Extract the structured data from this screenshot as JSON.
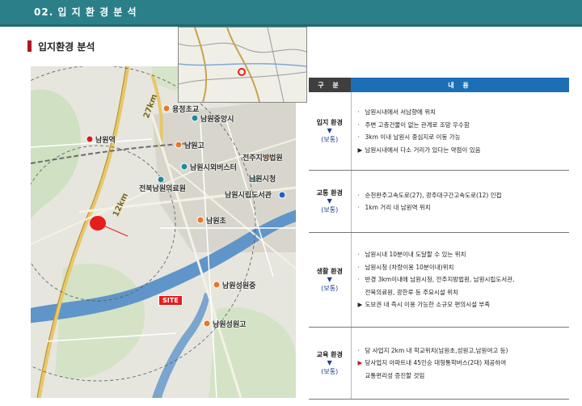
{
  "header": {
    "title": "02. 입 지 환 경 분 석"
  },
  "section": {
    "title": "입지환경 분석"
  },
  "map": {
    "site_label": "SITE",
    "road_labels": [
      "27km",
      "12km"
    ],
    "places": [
      {
        "label": "남원역",
        "kind": "station"
      },
      {
        "label": "용정초교",
        "kind": "school"
      },
      {
        "label": "남원중앙시",
        "kind": "facility"
      },
      {
        "label": "남원고",
        "kind": "school"
      },
      {
        "label": "남원시외버스터",
        "kind": "facility"
      },
      {
        "label": "전북남원의료원",
        "kind": "facility"
      },
      {
        "label": "전주지방법원",
        "kind": "facility"
      },
      {
        "label": "남원시청",
        "kind": "facility"
      },
      {
        "label": "남원시립도서관",
        "kind": "facility"
      },
      {
        "label": "남원초",
        "kind": "school"
      },
      {
        "label": "남원성원중",
        "kind": "school"
      },
      {
        "label": "남원성원고",
        "kind": "school"
      }
    ]
  },
  "table": {
    "header_category": "구 분",
    "header_content": "내 용",
    "rows": [
      {
        "category": "입지 환경",
        "arrow": "▼",
        "rating": "(보통)",
        "items": [
          {
            "mark": "·",
            "text": "남원시내에서 서남향에 위치",
            "emph": false,
            "cont": false
          },
          {
            "mark": "·",
            "text": "주변 고층건물이 없는 관계로 조망 우수함",
            "emph": false,
            "cont": false
          },
          {
            "mark": "·",
            "text": "3km 이내 남원시 중심지로 이동 가능",
            "emph": false,
            "cont": false
          },
          {
            "mark": "▶",
            "text": "남원시내에서 다소 거리가 있다는 약점이 있음",
            "emph": false,
            "cont": false
          }
        ]
      },
      {
        "category": "교통 환경",
        "arrow": "▼",
        "rating": "(보통)",
        "items": [
          {
            "mark": "·",
            "text": "순천완주고속도로(27), 광주대구간고속도로(12) 인접",
            "emph": false,
            "cont": false
          },
          {
            "mark": "·",
            "text": "1km 거리 내 남원역 위치",
            "emph": false,
            "cont": false
          }
        ]
      },
      {
        "category": "생활 환경",
        "arrow": "▼",
        "rating": "(보통)",
        "items": [
          {
            "mark": "·",
            "text": "남원시내 10분이내 도달할 수 있는 위치",
            "emph": false,
            "cont": false
          },
          {
            "mark": "·",
            "text": "남원시청 (차량이용 10분이내)위치",
            "emph": false,
            "cont": false
          },
          {
            "mark": "·",
            "text": "반경 3km이내에 남원시청, 전주지방법원, 남원시립도서관,",
            "emph": false,
            "cont": false
          },
          {
            "mark": "",
            "text": "전북의료원, 광한루 등 주요시설 위치",
            "emph": false,
            "cont": true
          },
          {
            "mark": "▶",
            "text": "도보권 내 즉시 이용 가능한 소규모 편의시설 부족",
            "emph": false,
            "cont": false
          }
        ]
      },
      {
        "category": "교육 환경",
        "arrow": "▼",
        "rating": "(보통)",
        "items": [
          {
            "mark": "·",
            "text": "당 사업지 2km 내 학교위치(남원초,성원고,남원여고 등)",
            "emph": false,
            "cont": false
          },
          {
            "mark": "▶",
            "text": "당사업지 아파트내 45인승 대형통학버스(2대) 제공하여",
            "emph": true,
            "cont": false
          },
          {
            "mark": "",
            "text": "교통편리성 증진할 것임",
            "emph": false,
            "cont": true
          }
        ]
      }
    ]
  },
  "colors": {
    "header_teal": "#2a7f89",
    "marker_red": "#b01722",
    "table_header_dark": "#3f3f3f",
    "table_header_blue": "#1c6fb5",
    "rating_blue": "#1c3f8a",
    "site_red": "#e41d1d",
    "school_orange": "#e8772a",
    "facility_teal": "#1e8b9c",
    "city_blue": "#1b64c8",
    "station_red": "#d61a1a"
  }
}
